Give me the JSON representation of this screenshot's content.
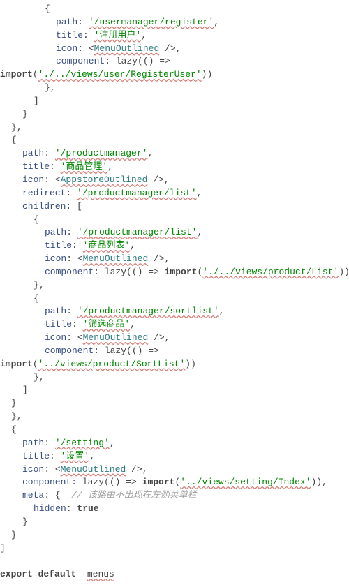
{
  "file_kind": "JavaScript / React source (editor view with spell-check warnings)",
  "export_line": {
    "export": "export",
    "default": "default",
    "ident": "menus"
  },
  "blocks": [
    {
      "type": "child_route",
      "path": "/usermanager/register",
      "title": "注册用户",
      "icon": "MenuOutlined",
      "component_lazy": "./../views/user/RegisterUser"
    },
    {
      "type": "parent_route",
      "path": "/productmanager",
      "title": "商品管理",
      "icon": "AppstoreOutlined",
      "redirect": "/productmanager/list",
      "children": [
        {
          "path": "/productmanager/list",
          "title": "商品列表",
          "icon": "MenuOutlined",
          "component_lazy": "./../views/product/List"
        },
        {
          "path": "/productmanager/sortlist",
          "title": "筛选商品",
          "icon": "MenuOutlined",
          "component_lazy": "../views/product/SortList"
        }
      ]
    },
    {
      "type": "meta_route",
      "path": "/setting",
      "title": "设置",
      "icon": "MenuOutlined",
      "component_lazy": "../views/setting/Index",
      "meta_comment": "// 该路由不出现在左侧菜单栏",
      "meta_hidden_key": "hidden",
      "meta_hidden_value": "true"
    }
  ],
  "tokens": {
    "path": "path",
    "title": "title",
    "icon": "icon",
    "component": "component",
    "redirect": "redirect",
    "children": "children",
    "meta": "meta",
    "lazy": "lazy",
    "import": "import"
  }
}
